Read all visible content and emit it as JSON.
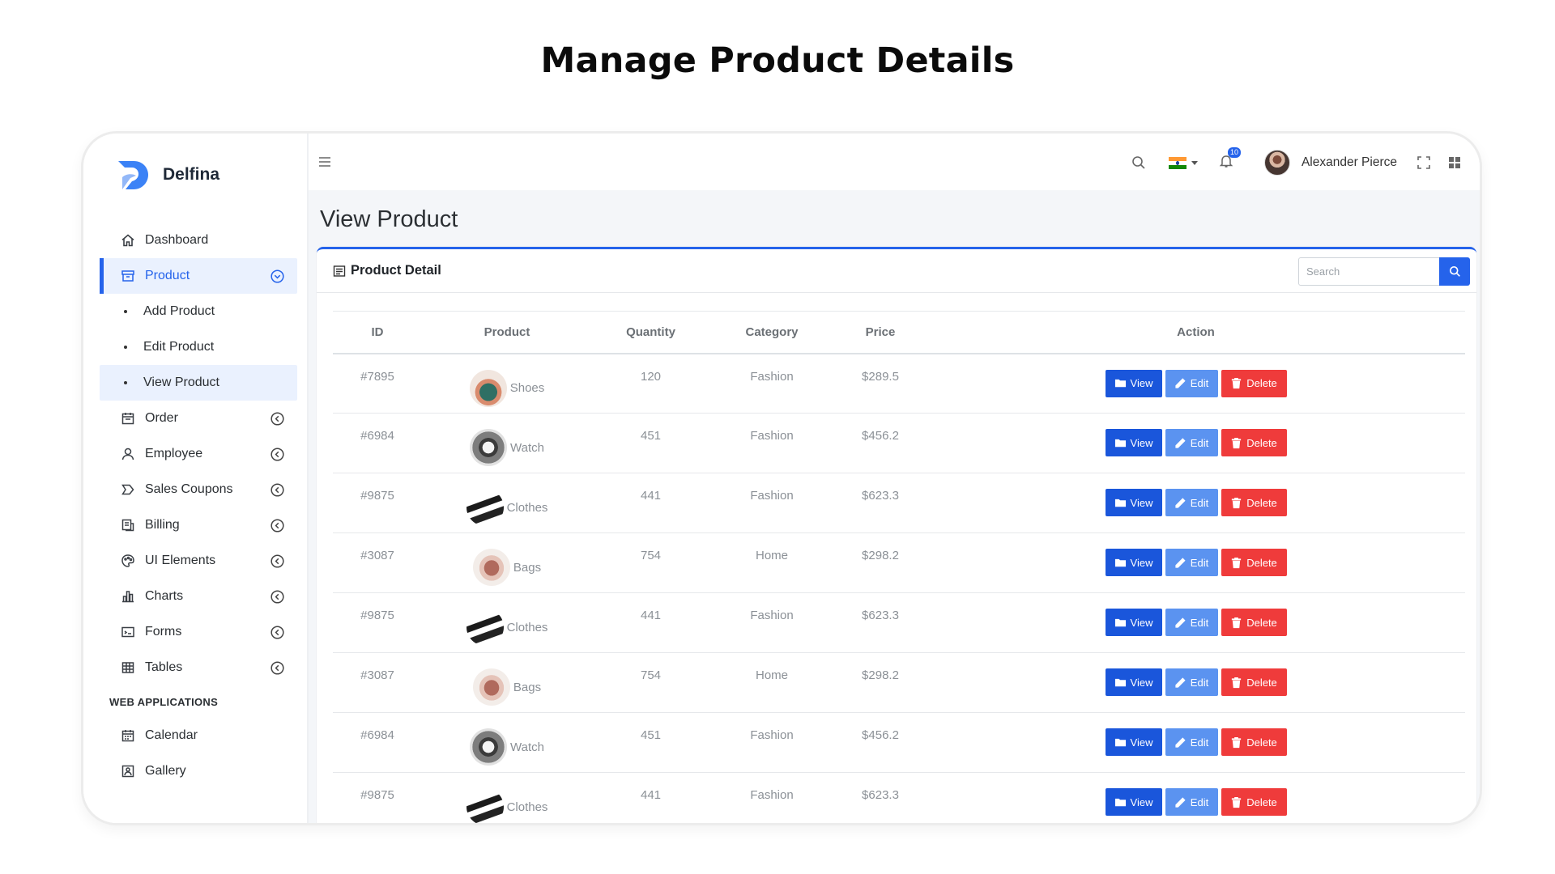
{
  "heading": "Manage Product Details",
  "brand": {
    "name": "Delfina"
  },
  "sidebar": {
    "items": [
      {
        "label": "Dashboard",
        "icon": "home-icon"
      },
      {
        "label": "Product",
        "icon": "archive-icon"
      },
      {
        "label": "Add Product"
      },
      {
        "label": "Edit Product"
      },
      {
        "label": "View Product"
      },
      {
        "label": "Order",
        "icon": "calendar-icon"
      },
      {
        "label": "Employee",
        "icon": "user-icon"
      },
      {
        "label": "Sales Coupons",
        "icon": "tag-icon"
      },
      {
        "label": "Billing",
        "icon": "invoice-icon"
      },
      {
        "label": "UI Elements",
        "icon": "palette-icon"
      },
      {
        "label": "Charts",
        "icon": "bar-chart-icon"
      },
      {
        "label": "Forms",
        "icon": "form-icon"
      },
      {
        "label": "Tables",
        "icon": "table-icon"
      }
    ],
    "section": "WEB APPLICATIONS",
    "apps": [
      {
        "label": "Calendar",
        "icon": "calendar-icon"
      },
      {
        "label": "Gallery",
        "icon": "image-icon"
      }
    ]
  },
  "topbar": {
    "notification_count": "10",
    "user_name": "Alexander Pierce"
  },
  "page_title": "View Product",
  "card": {
    "title": "Product Detail",
    "search_placeholder": "Search"
  },
  "table": {
    "headers": [
      "ID",
      "Product",
      "Quantity",
      "Category",
      "Price",
      "Action"
    ],
    "rows": [
      {
        "id": "#7895",
        "product": "Shoes",
        "quantity": "120",
        "category": "Fashion",
        "price": "$289.5"
      },
      {
        "id": "#6984",
        "product": "Watch",
        "quantity": "451",
        "category": "Fashion",
        "price": "$456.2"
      },
      {
        "id": "#9875",
        "product": "Clothes",
        "quantity": "441",
        "category": "Fashion",
        "price": "$623.3"
      },
      {
        "id": "#3087",
        "product": "Bags",
        "quantity": "754",
        "category": "Home",
        "price": "$298.2"
      },
      {
        "id": "#9875",
        "product": "Clothes",
        "quantity": "441",
        "category": "Fashion",
        "price": "$623.3"
      },
      {
        "id": "#3087",
        "product": "Bags",
        "quantity": "754",
        "category": "Home",
        "price": "$298.2"
      },
      {
        "id": "#6984",
        "product": "Watch",
        "quantity": "451",
        "category": "Fashion",
        "price": "$456.2"
      },
      {
        "id": "#9875",
        "product": "Clothes",
        "quantity": "441",
        "category": "Fashion",
        "price": "$623.3"
      }
    ]
  },
  "actions": {
    "view": "View",
    "edit": "Edit",
    "delete": "Delete"
  },
  "colors": {
    "primary": "#2563eb",
    "edit": "#5b93f0",
    "delete": "#ef3b3b"
  }
}
